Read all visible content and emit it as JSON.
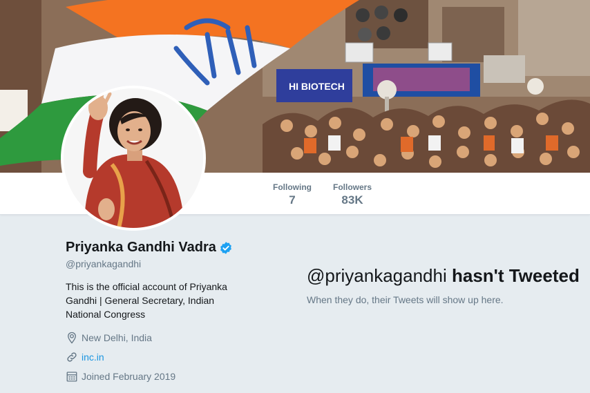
{
  "banner": {
    "signs": [
      "HI BIOTECH"
    ],
    "flag_colors": {
      "saffron": "#f47321",
      "white": "#f5f5f7",
      "green": "#2e9a3e",
      "symbol": "#2f5fb8"
    }
  },
  "nav": {
    "following_label": "Following",
    "following_count": "7",
    "followers_label": "Followers",
    "followers_count": "83K"
  },
  "profile": {
    "name": "Priyanka Gandhi Vadra",
    "verified": true,
    "handle": "@priyankagandhi",
    "bio": "This is the official account of Priyanka Gandhi | General Secretary, Indian National Congress",
    "location_icon": "location-pin-icon",
    "location": "New Delhi, India",
    "url_icon": "link-icon",
    "url": "inc.in",
    "joined_icon": "calendar-icon",
    "joined": "Joined February 2019"
  },
  "timeline": {
    "empty_handle": "@priyankagandhi",
    "empty_title_bold": "hasn't Tweeted",
    "empty_subtitle": "When they do, their Tweets will show up here."
  },
  "colors": {
    "accent": "#1b95e0",
    "verified": "#1da1f2",
    "muted": "#657786",
    "background": "#e6ecf0"
  }
}
